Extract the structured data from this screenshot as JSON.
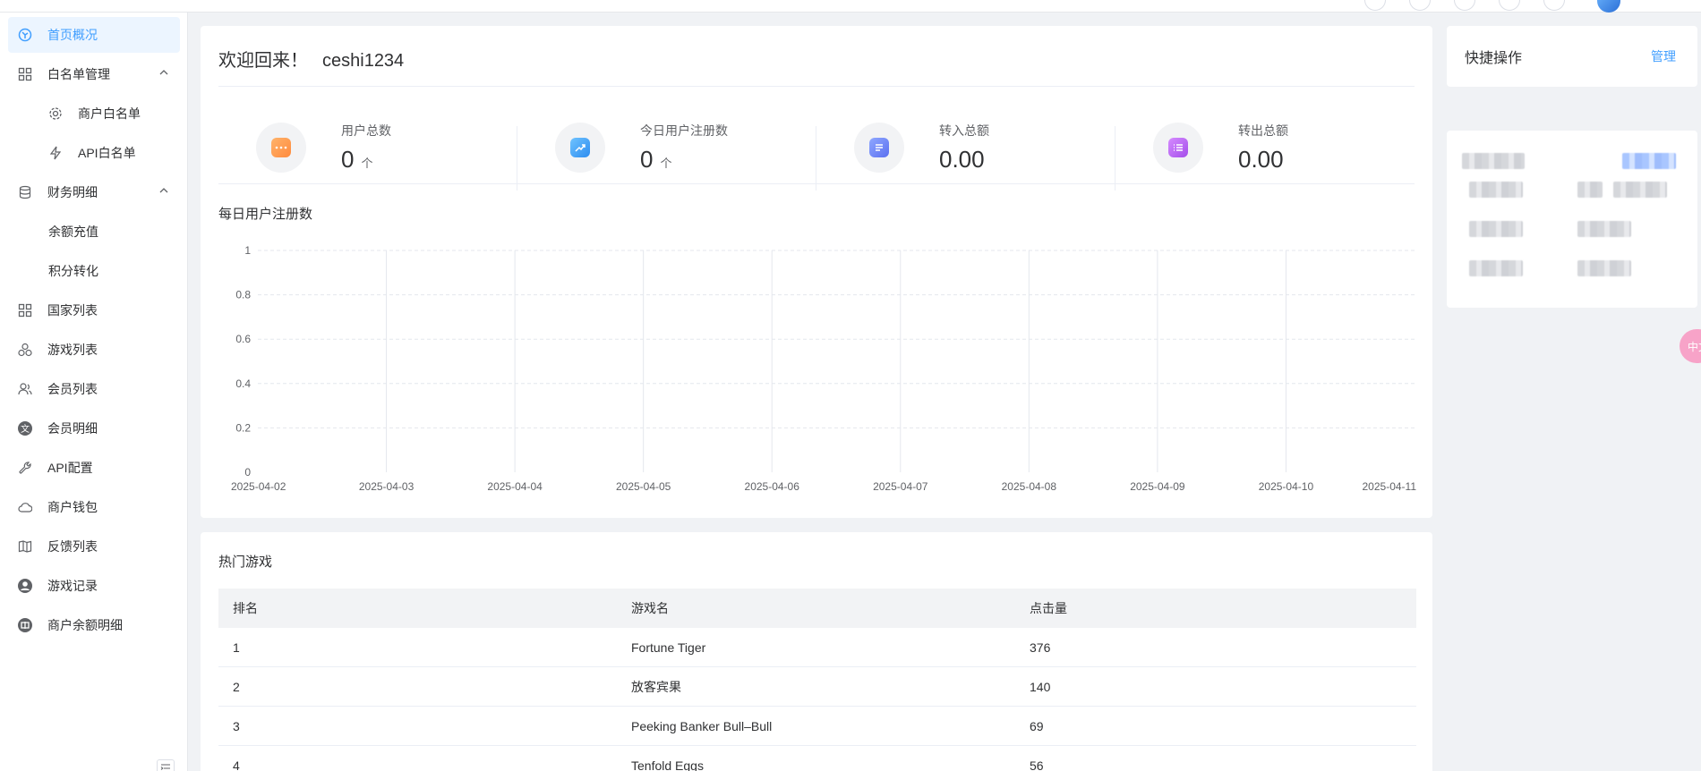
{
  "sidebar": {
    "items": [
      {
        "label": "首页概况"
      },
      {
        "label": "白名单管理"
      },
      {
        "label": "商户白名单"
      },
      {
        "label": "API白名单"
      },
      {
        "label": "财务明细"
      },
      {
        "label": "余额充值"
      },
      {
        "label": "积分转化"
      },
      {
        "label": "国家列表"
      },
      {
        "label": "游戏列表"
      },
      {
        "label": "会员列表"
      },
      {
        "label": "会员明细"
      },
      {
        "label": "API配置"
      },
      {
        "label": "商户钱包"
      },
      {
        "label": "反馈列表"
      },
      {
        "label": "游戏记录"
      },
      {
        "label": "商户余额明细"
      }
    ]
  },
  "welcome": {
    "text": "欢迎回来！",
    "username": "ceshi1234"
  },
  "stats": [
    {
      "title": "用户总数",
      "value": "0",
      "unit": "个"
    },
    {
      "title": "今日用户注册数",
      "value": "0",
      "unit": "个"
    },
    {
      "title": "转入总额",
      "value": "0.00",
      "unit": ""
    },
    {
      "title": "转出总额",
      "value": "0.00",
      "unit": ""
    }
  ],
  "chart": {
    "title": "每日用户注册数"
  },
  "chart_data": {
    "type": "line",
    "title": "每日用户注册数",
    "x": [
      "2025-04-02",
      "2025-04-03",
      "2025-04-04",
      "2025-04-05",
      "2025-04-06",
      "2025-04-07",
      "2025-04-08",
      "2025-04-09",
      "2025-04-10",
      "2025-04-11"
    ],
    "series": [
      {
        "values": [
          0,
          0,
          0,
          0,
          0,
          0,
          0,
          0,
          0,
          0
        ]
      }
    ],
    "ylim": [
      0,
      1
    ],
    "yticks": [
      "0",
      "0.2",
      "0.4",
      "0.6",
      "0.8",
      "1"
    ],
    "grid": true,
    "colors": {
      "line_start": "#36d1ff",
      "line_end": "#7b5cff"
    }
  },
  "hot_games": {
    "title": "热门游戏",
    "columns": [
      "排名",
      "游戏名",
      "点击量"
    ],
    "rows": [
      [
        "1",
        "Fortune Tiger",
        "376"
      ],
      [
        "2",
        "放客宾果",
        "140"
      ],
      [
        "3",
        "Peeking Banker Bull–Bull",
        "69"
      ],
      [
        "4",
        "Tenfold Eggs",
        "56"
      ]
    ]
  },
  "quick": {
    "title": "快捷操作",
    "manage": "管理"
  },
  "float_tab": {
    "label": "中文"
  },
  "colors": {
    "accent": "#409eff",
    "active_bg": "#ecf5ff",
    "page_bg": "#f0f2f5"
  }
}
